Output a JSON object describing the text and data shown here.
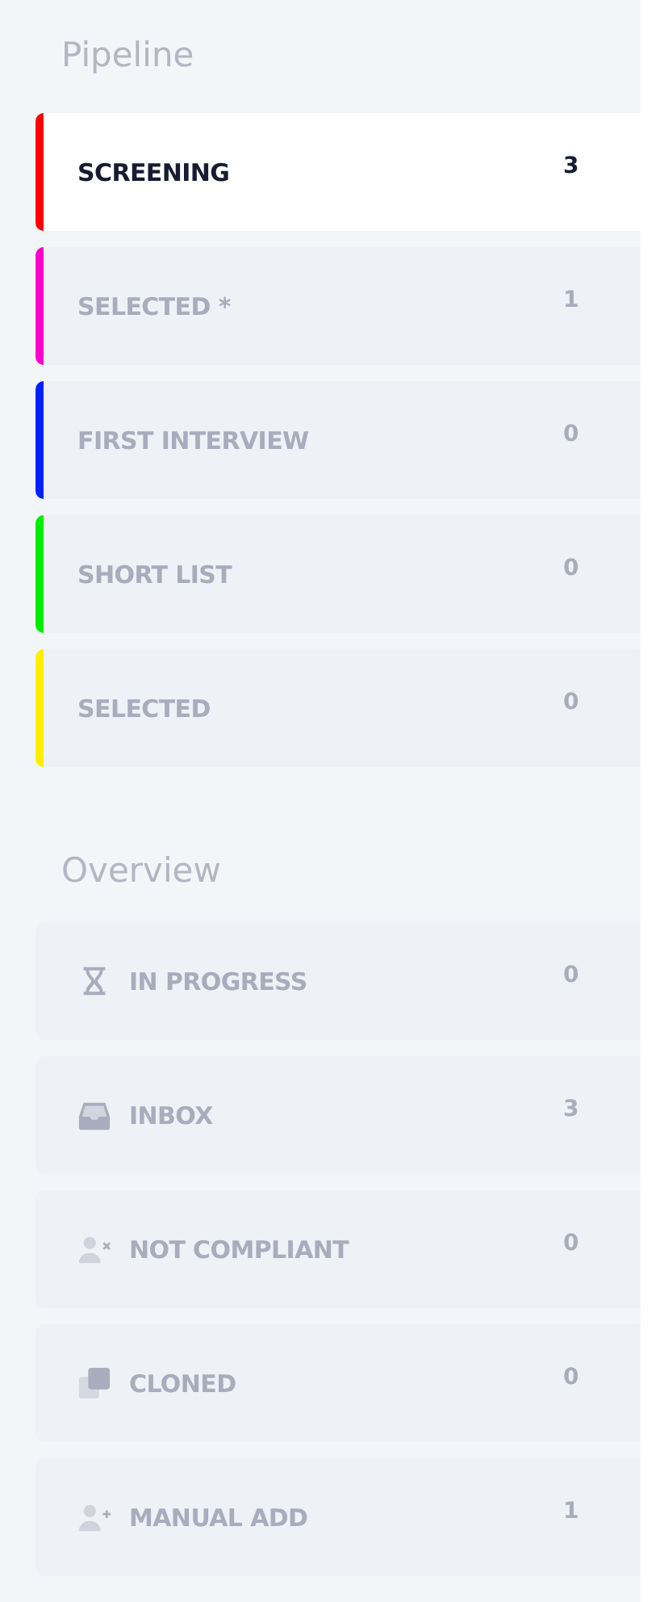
{
  "pipeline": {
    "title": "Pipeline",
    "stages": [
      {
        "label": "SCREENING",
        "count": "3",
        "color": "#ff0000",
        "selected": true
      },
      {
        "label": "SELECTED *",
        "count": "1",
        "color": "#ff00cc",
        "selected": false
      },
      {
        "label": "FIRST INTERVIEW",
        "count": "0",
        "color": "#0022ff",
        "selected": false
      },
      {
        "label": "SHORT LIST",
        "count": "0",
        "color": "#00ee00",
        "selected": false
      },
      {
        "label": "SELECTED",
        "count": "0",
        "color": "#ffee00",
        "selected": false
      }
    ]
  },
  "overview": {
    "title": "Overview",
    "items": [
      {
        "kind": "hourglass",
        "label": "IN PROGRESS",
        "count": "0"
      },
      {
        "kind": "inbox",
        "label": "INBOX",
        "count": "3"
      },
      {
        "kind": "person-remove",
        "label": "NOT COMPLIANT",
        "count": "0"
      },
      {
        "kind": "clone",
        "label": "CLONED",
        "count": "0"
      },
      {
        "kind": "person-add",
        "label": "MANUAL ADD",
        "count": "1"
      }
    ]
  }
}
